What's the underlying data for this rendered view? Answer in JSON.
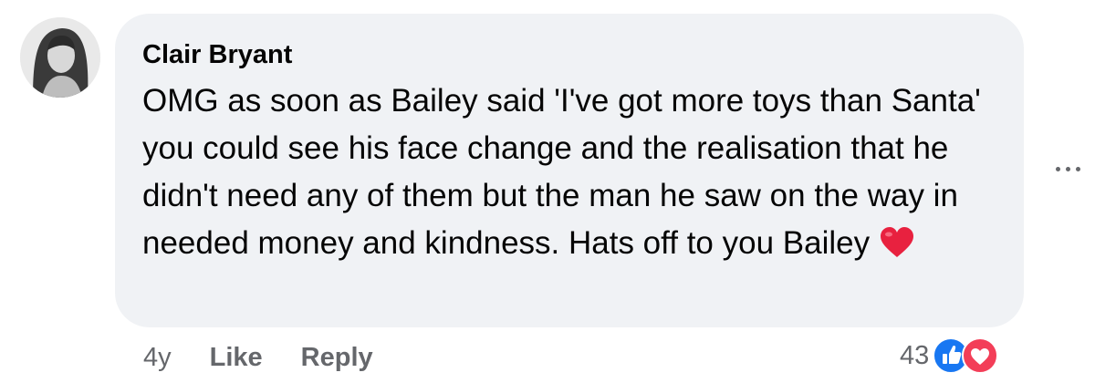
{
  "comment": {
    "author": "Clair Bryant",
    "text": "OMG as soon as Bailey said 'I've got more toys than Santa' you could see his face change and the realisation that he didn't need any of them but the man he saw on the way in needed money and kindness. Hats off to you Bailey",
    "trailing_emoji": "red-heart-icon"
  },
  "actions": {
    "time": "4y",
    "like_label": "Like",
    "reply_label": "Reply"
  },
  "reactions": {
    "count": "43",
    "types": [
      "like-reaction-icon",
      "love-reaction-icon"
    ]
  },
  "colors": {
    "bubble": "#f0f2f5",
    "secondary_text": "#65676b",
    "like_blue": "#1877f2",
    "love_red": "#f33e58"
  }
}
